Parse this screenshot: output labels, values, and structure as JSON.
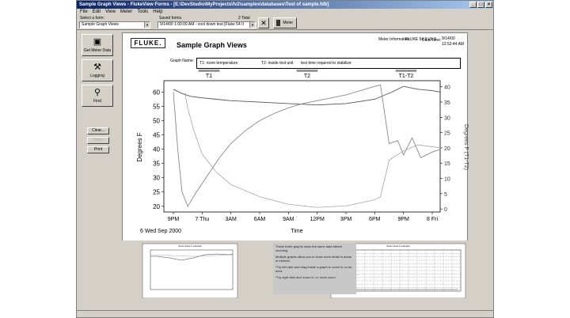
{
  "window": {
    "title": "Sample Graph Views - FlukeView Forms - [E:\\DevStudio\\MyProjects\\fv2\\samples\\databases\\Test of sample.fdb]"
  },
  "menu": [
    "File",
    "Edit",
    "View",
    "Meter",
    "Tools",
    "Help"
  ],
  "form_bar": {
    "select_form_label": "Select a form:",
    "select_form_value": "Sample Graph Views",
    "saved_forms_label": "Saved forms",
    "saved_forms_value": "9/14/00 1:00:09 AM - cool down test [Fluke 54 II",
    "total_label": "2 Total",
    "meter_label": "Meter"
  },
  "sidebar": {
    "get_meter_data": "Get Meter Data",
    "logging": "Logging",
    "find": "Find",
    "clear": "Clear...",
    "disabled": "Save",
    "print": "Print"
  },
  "form": {
    "logo": "FLUKE.",
    "page_title": "Sample Graph Views",
    "meter_info_label": "Meter Information:",
    "meter_info_value": "FLUKE 54 II   V1.0",
    "datetime_label": "Date/Time:",
    "date_value": "9/14/00",
    "time_value": "12:52:44 AM",
    "graph_name_label": "Graph Name:",
    "graph_name_t1": "T1: room temperature",
    "graph_name_t2": "T2: inside test unit",
    "graph_name_t1t2": "test time required to stabilize",
    "note_p1": "These three graphs show the same data before zooming.",
    "note_p2": "Multiple graphs allow you to show more detail in areas of interest.",
    "note_p3": "*Try left click and drag inside a graph to zoom in on an area.",
    "note_p4": "*Try right click and 'zoom in' or 'undo zoom'",
    "mini_left_title": "Zoom Area 1 example",
    "mini_right_title": "Zoom Area 2 example"
  },
  "colors": {
    "titlebar_start": "#0a246a",
    "titlebar_end": "#a6caf0",
    "window_bg": "#d4d0c8",
    "series_t1": "#555555",
    "series_t2": "#888888",
    "series_t1t2": "#999999"
  },
  "chart_data": {
    "type": "line",
    "title": "",
    "xlabel": "Time",
    "ylabel": "Degrees F",
    "ylabel_right": "Degrees F  (T1-T2)",
    "x_ticks": [
      "9PM",
      "7 Thu",
      "3AM",
      "6AM",
      "9AM",
      "12PM",
      "3PM",
      "6PM",
      "9PM",
      "8 Fri"
    ],
    "x_date_label": "6 Wed Sep 2000",
    "ylim": [
      18,
      64
    ],
    "y_ticks": [
      20,
      25,
      30,
      35,
      40,
      45,
      50,
      55,
      60
    ],
    "y2lim": [
      -1,
      42
    ],
    "y2_ticks": [
      0,
      5,
      10,
      15,
      20,
      25,
      30,
      35,
      40
    ],
    "legend_tabs": [
      "T1",
      "T2",
      "T1-T2"
    ],
    "grid": false,
    "series": [
      {
        "name": "T1",
        "axis": "left",
        "x": [
          0,
          0.3,
          0.6,
          1.0,
          1.5,
          2.0,
          3.0,
          4.0,
          5.0,
          6.0,
          7.0,
          7.6,
          8.0,
          8.5,
          9.0,
          9.3
        ],
        "y": [
          61,
          59.5,
          58.5,
          58,
          57.5,
          57,
          56.5,
          56,
          55.5,
          56,
          57.5,
          60,
          62,
          61,
          60.5,
          60
        ]
      },
      {
        "name": "T2",
        "axis": "left",
        "x": [
          0,
          0.15,
          0.3,
          0.5,
          0.8,
          1.2,
          1.6,
          2.0,
          2.5,
          3.0,
          3.5,
          4.0,
          4.5,
          5.0,
          5.5,
          6.0,
          6.5,
          7.0,
          7.2,
          7.5,
          7.8,
          8.0,
          8.3,
          8.6,
          9.0,
          9.3
        ],
        "y": [
          60,
          40,
          25,
          20,
          25,
          31,
          37,
          42,
          46.5,
          50,
          52.5,
          54.5,
          56,
          57,
          58,
          59,
          60.5,
          62,
          62.5,
          42,
          43,
          38,
          44,
          37,
          39,
          40
        ]
      },
      {
        "name": "T1-T2",
        "axis": "right",
        "x": [
          0.4,
          0.5,
          0.7,
          1.0,
          1.5,
          2.0,
          3.0,
          4.0,
          5.0,
          6.0,
          7.0,
          7.2,
          7.5,
          8.0,
          8.5,
          9.3
        ],
        "y": [
          38,
          33,
          26,
          18,
          12,
          8,
          4,
          1.5,
          0.5,
          1,
          3,
          4,
          16,
          19,
          21,
          20
        ]
      }
    ]
  }
}
